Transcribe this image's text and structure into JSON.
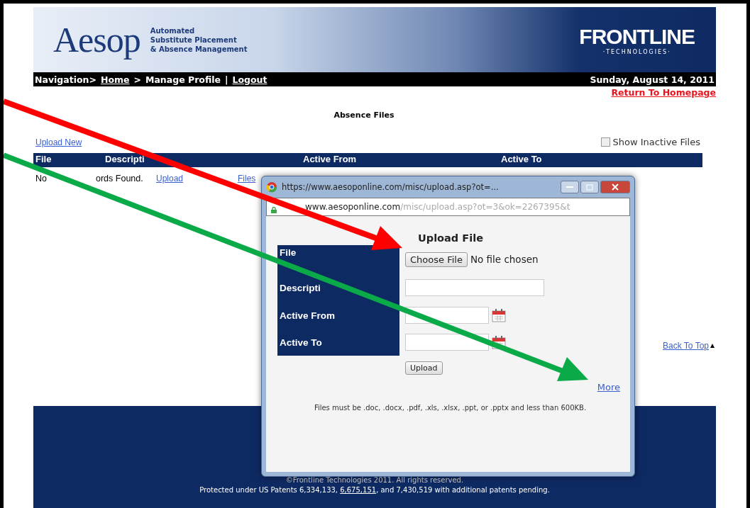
{
  "header": {
    "logo": "Aesop",
    "tagline": [
      "Automated",
      "Substitute Placement",
      "& Absence Management"
    ],
    "brand": "FRONTLINE",
    "brand_sub": "·TECHNOLOGIES·"
  },
  "nav": {
    "items": [
      {
        "kind": "text",
        "label": "Navigation>"
      },
      {
        "kind": "link",
        "label": "Home"
      },
      {
        "kind": "text",
        "label": ">"
      },
      {
        "kind": "text",
        "label": "Manage Profile"
      },
      {
        "kind": "text",
        "label": "|"
      },
      {
        "kind": "link",
        "label": "Logout"
      }
    ],
    "date": "Sunday, August 14, 2011"
  },
  "return_link": "Return To Homepage",
  "page_title": "Absence Files",
  "upload_link": "Upload New",
  "show_inactive": {
    "label": "Show Inactive Files",
    "checked": false
  },
  "table": {
    "columns": [
      "File",
      "Descripti",
      "Active From",
      "Active To"
    ],
    "empty_row": [
      {
        "kind": "text",
        "label": "No"
      },
      {
        "kind": "text",
        "label": "ords Found."
      },
      {
        "kind": "link",
        "label": "Upload"
      },
      {
        "kind": "link",
        "label": "Files"
      }
    ]
  },
  "back_to_top": "Back To Top",
  "footer": {
    "copyright": "©Frontline Technologies 2011. All rights reserved.",
    "patents_before": "Protected under US Patents 6,334,133,",
    "patent_link": "6,675,151",
    "patents_after": ", and 7,430,519 with additional patents pending."
  },
  "dialog": {
    "title": "https://www.aesoponline.com/misc/upload.asp?ot=...",
    "address_host": "www.aesoponline.com",
    "address_path": "/misc/upload.asp?ot=3&ok=2267395&t",
    "heading": "Upload File",
    "fields": [
      {
        "label": "File",
        "kind": "file",
        "button": "Choose File",
        "status": "No file chosen"
      },
      {
        "label": "Descripti",
        "kind": "text"
      },
      {
        "label": "Active From",
        "kind": "date"
      },
      {
        "label": "Active To",
        "kind": "date"
      }
    ],
    "submit": "Upload",
    "more": "More",
    "notice": "Files must be .doc, .docx, .pdf, .xls, .xlsx, .ppt, or .pptx and less than 600KB."
  }
}
